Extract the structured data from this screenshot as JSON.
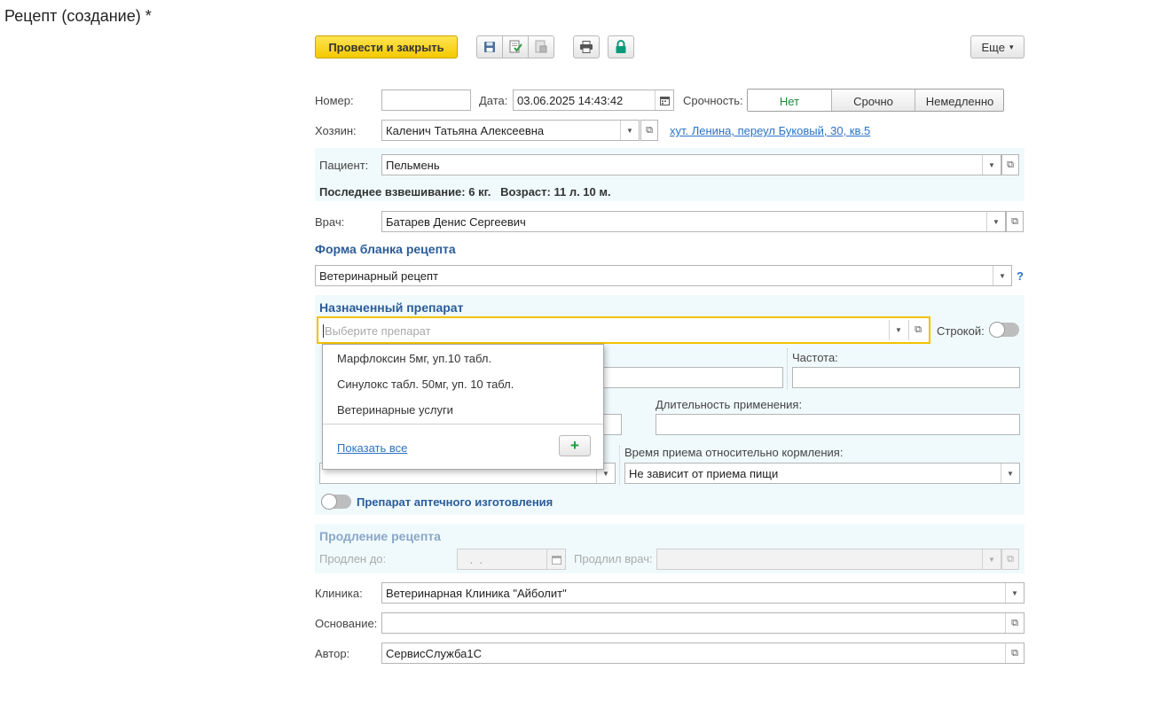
{
  "window": {
    "title": "Рецепт (создание) *"
  },
  "toolbar": {
    "post_close_label": "Провести и закрыть",
    "more_label": "Еще",
    "more_arrow": "▾"
  },
  "header": {
    "number_label": "Номер:",
    "number_value": "",
    "date_label": "Дата:",
    "date_value": "03.06.2025 14:43:42",
    "urgency_label": "Срочность:",
    "urgency_options": [
      "Нет",
      "Срочно",
      "Немедленно"
    ],
    "urgency_selected": "Нет",
    "owner_label": "Хозяин:",
    "owner_value": "Каленич Татьяна Алексеевна",
    "owner_address": "хут. Ленина, переул Буковый, 30, кв.5"
  },
  "patient": {
    "label": "Пациент:",
    "value": "Пельмень",
    "info": "Последнее взвешивание: 6 кг.   Возраст: 11 л. 10 м."
  },
  "doctor": {
    "label": "Врач:",
    "value": "Батарев Денис Сергеевич"
  },
  "form_blank": {
    "title": "Форма бланка рецепта",
    "value": "Ветеринарный рецепт",
    "help": "?"
  },
  "drug": {
    "title": "Назначенный препарат",
    "placeholder": "Выберите препарат",
    "line_label": "Строкой:",
    "frequency_label": "Частота:",
    "frequency_value": "",
    "duration_label": "Длительность применения:",
    "duration_value": "",
    "feeding_label": "Время приема относительно кормления:",
    "feeding_value": "Не зависит от приема пищи",
    "pharmacy_label": "Препарат аптечного изготовления",
    "dropdown": {
      "items": [
        "Марфлоксин 5мг, уп.10 табл.",
        "Синулокс табл. 50мг, уп. 10 табл.",
        "Ветеринарные услуги"
      ],
      "show_all": "Показать все",
      "add": "+"
    }
  },
  "extension": {
    "title": "Продление рецепта",
    "until_label": "Продлен до:",
    "until_value": " .  .",
    "doctor_label": "Продлил врач:",
    "doctor_value": ""
  },
  "footer": {
    "clinic_label": "Клиника:",
    "clinic_value": "Ветеринарная Клиника \"Айболит\"",
    "basis_label": "Основание:",
    "basis_value": "",
    "author_label": "Автор:",
    "author_value": "СервисСлужба1С"
  },
  "colors": {
    "primary_button": "#f5cc00",
    "section_background": "#f0fafc",
    "section_title": "#2a5c9a",
    "link": "#2a73c5",
    "urgency_selected_text": "#1d8a3a"
  }
}
